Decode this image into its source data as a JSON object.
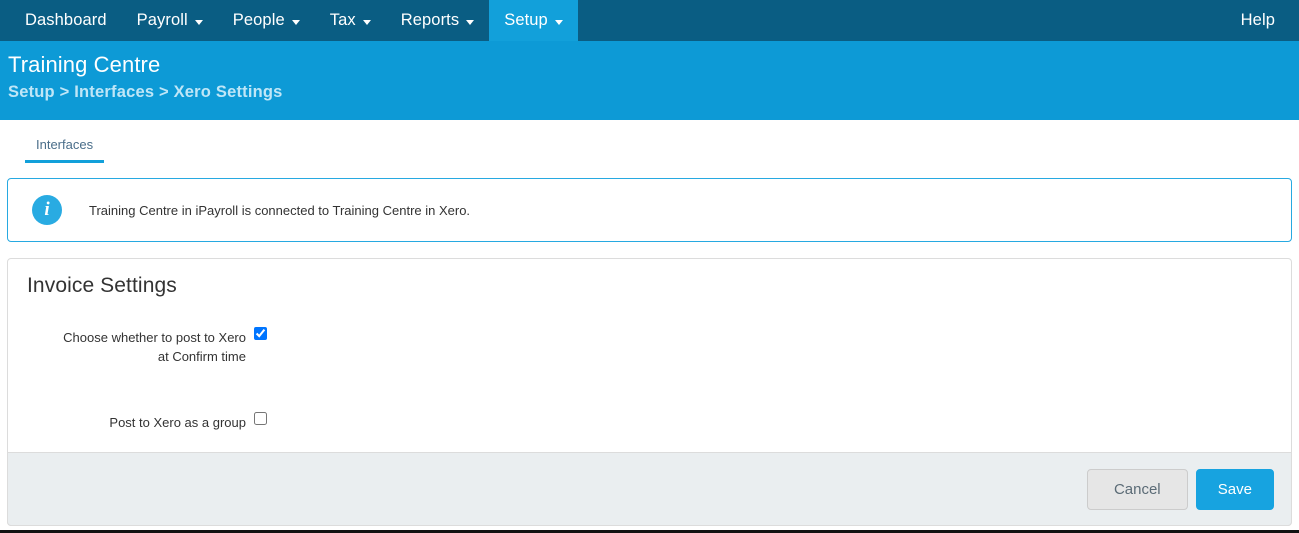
{
  "topnav": {
    "items": [
      {
        "label": "Dashboard",
        "has_caret": false,
        "active": false
      },
      {
        "label": "Payroll",
        "has_caret": true,
        "active": false
      },
      {
        "label": "People",
        "has_caret": true,
        "active": false
      },
      {
        "label": "Tax",
        "has_caret": true,
        "active": false
      },
      {
        "label": "Reports",
        "has_caret": true,
        "active": false
      },
      {
        "label": "Setup",
        "has_caret": true,
        "active": true
      }
    ],
    "help_label": "Help",
    "background_color": "#0a5d83",
    "active_color": "#12a0da"
  },
  "pagehead": {
    "title": "Training Centre",
    "breadcrumb": "Setup > Interfaces > Xero Settings",
    "background_color": "#0d9ad6"
  },
  "tabs": [
    {
      "label": "Interfaces",
      "active": true
    }
  ],
  "info_banner": {
    "icon": "info-circle-icon",
    "icon_glyph": "i",
    "message": "Training Centre in iPayroll is connected to Training Centre in Xero.",
    "border_color": "#27a9e1",
    "icon_color": "#29abe2"
  },
  "panel": {
    "title": "Invoice Settings",
    "fields": [
      {
        "label": "Choose whether to post to Xero at Confirm time",
        "label_line1": "Choose whether to post to Xero",
        "label_line2": "at Confirm time",
        "type": "checkbox",
        "checked": true
      },
      {
        "label": "Post to Xero as a group",
        "label_line1": "Post to Xero as a group",
        "label_line2": "",
        "type": "checkbox",
        "checked": false
      }
    ]
  },
  "footer": {
    "cancel_label": "Cancel",
    "save_label": "Save",
    "save_color": "#17a3e0",
    "background_color": "#eaeef0"
  }
}
